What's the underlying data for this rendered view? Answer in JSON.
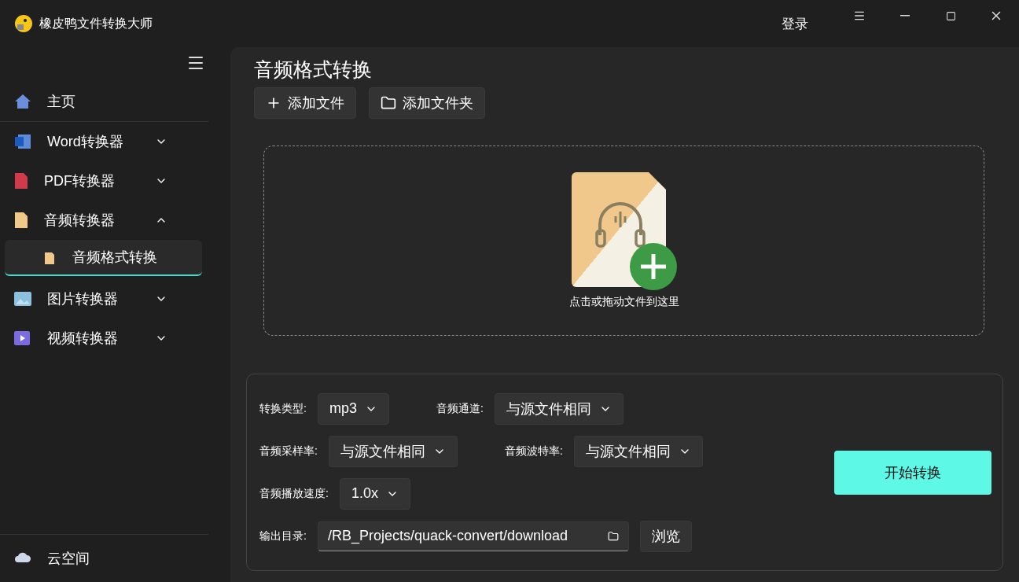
{
  "window": {
    "title": "橡皮鸭文件转换大师",
    "login": "登录"
  },
  "sidebar": {
    "items": [
      {
        "kind": "home",
        "label": "主页"
      },
      {
        "kind": "word",
        "label": "Word转换器",
        "expanded": false
      },
      {
        "kind": "pdf",
        "label": "PDF转换器",
        "expanded": false
      },
      {
        "kind": "audio",
        "label": "音频转换器",
        "expanded": true,
        "children": [
          {
            "label": "音频格式转换",
            "selected": true
          }
        ]
      },
      {
        "kind": "image",
        "label": "图片转换器",
        "expanded": false
      },
      {
        "kind": "video",
        "label": "视频转换器",
        "expanded": false
      }
    ],
    "footer": {
      "label": "云空间"
    }
  },
  "page": {
    "title": "音频格式转换",
    "buttons": [
      {
        "kind": "file",
        "label": "添加文件"
      },
      {
        "kind": "folder",
        "label": "添加文件夹"
      }
    ],
    "dropzone": {
      "hint": "点击或拖动文件到这里"
    }
  },
  "settings": {
    "rows": [
      [
        {
          "label": "转换类型:",
          "value": "mp3"
        },
        {
          "label": "音频通道:",
          "value": "与源文件相同"
        }
      ],
      [
        {
          "label": "音频采样率:",
          "value": "与源文件相同"
        },
        {
          "label": "音频波特率:",
          "value": "与源文件相同"
        }
      ],
      [
        {
          "label": "音频播放速度:",
          "value": "1.0x"
        }
      ]
    ],
    "output": {
      "label": "输出目录:",
      "value": "/RB_Projects/quack-convert/download",
      "browse": "浏览"
    },
    "start": "开始转换"
  }
}
